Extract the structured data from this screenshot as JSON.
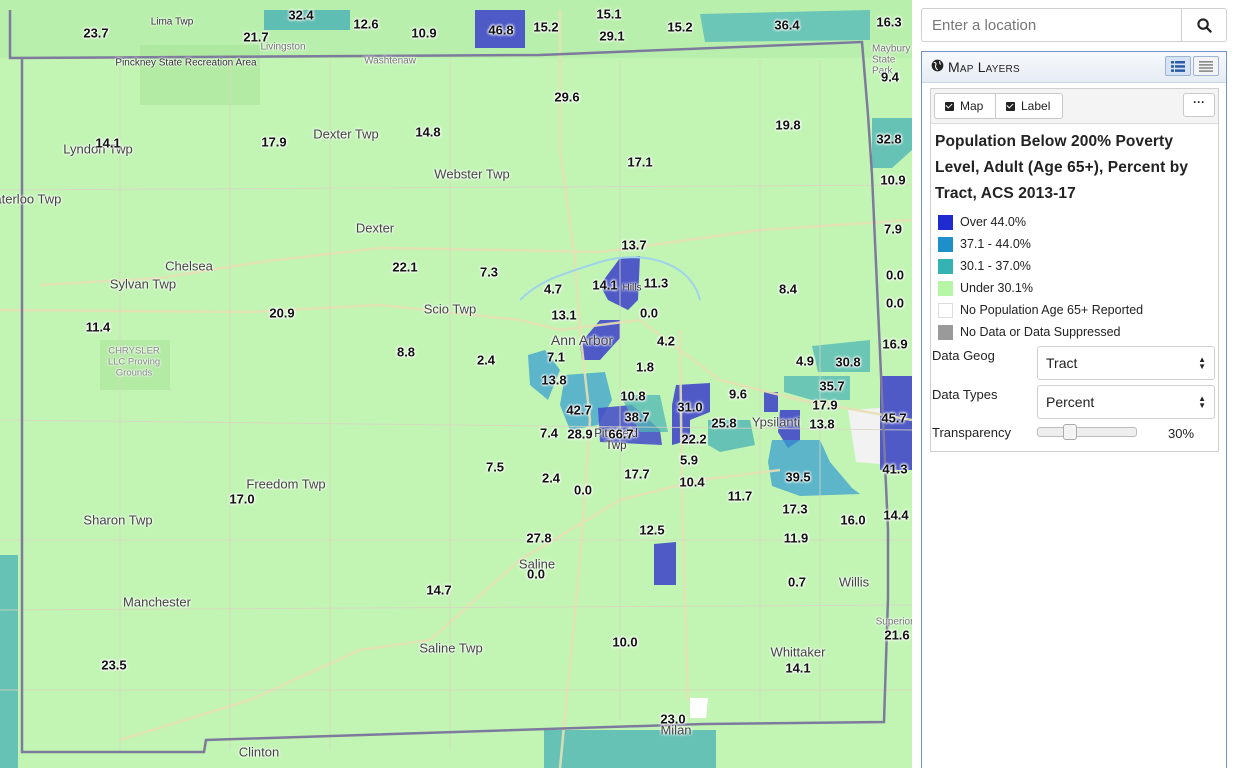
{
  "search": {
    "placeholder": "Enter a location"
  },
  "panel": {
    "title": "Map Layers",
    "toggles": {
      "map_label": "Map",
      "label_label": "Label"
    },
    "more_label": "···",
    "layer_title": "Population Below 200% Poverty Level, Adult (Age 65+), Percent by Tract, ACS 2013-17",
    "legend": [
      {
        "label": "Over 44.0%",
        "color": "#1f2bd0"
      },
      {
        "label": "37.1 - 44.0%",
        "color": "#1e8fc8"
      },
      {
        "label": "30.1 - 37.0%",
        "color": "#35b3b3"
      },
      {
        "label": "Under 30.1%",
        "color": "#b6f6a6"
      },
      {
        "label": "No Population Age 65+ Reported",
        "color": "#ffffff"
      },
      {
        "label": "No Data or Data Suppressed",
        "color": "#9a9a9a"
      }
    ],
    "data_geog": {
      "label": "Data Geog",
      "value": "Tract"
    },
    "data_types": {
      "label": "Data Types",
      "value": "Percent"
    },
    "transparency": {
      "label": "Transparency",
      "value": 0.3,
      "display": "30%"
    }
  },
  "map": {
    "values": [
      "32.4",
      "12.6",
      "10.9",
      "46.8",
      "15.2",
      "15.1",
      "29.1",
      "15.2",
      "36.4",
      "16.3",
      "23.7",
      "21.7",
      "9.4",
      "29.6",
      "14.1",
      "17.9",
      "14.8",
      "19.8",
      "32.8",
      "17.1",
      "10.9",
      "7.9",
      "13.7",
      "22.1",
      "7.3",
      "4.7",
      "14.1",
      "11.3",
      "8.4",
      "0.0",
      "0.0",
      "11.4",
      "20.9",
      "13.1",
      "0.0",
      "4.2",
      "16.9",
      "8.8",
      "2.4",
      "7.1",
      "1.8",
      "4.9",
      "30.8",
      "13.8",
      "35.7",
      "10.8",
      "9.6",
      "31.0",
      "17.9",
      "45.7",
      "42.7",
      "38.7",
      "25.8",
      "13.8",
      "7.4",
      "28.9",
      "66.7",
      "22.2",
      "41.3",
      "5.9",
      "7.5",
      "2.4",
      "17.7",
      "10.4",
      "39.5",
      "17.0",
      "0.0",
      "11.7",
      "17.3",
      "16.0",
      "14.4",
      "12.5",
      "27.8",
      "11.9",
      "0.0",
      "0.7",
      "14.7",
      "10.0",
      "21.6",
      "23.5",
      "14.1",
      "23.0"
    ],
    "places": [
      "Pinckney State Recreation Area",
      "Lyndon Twp",
      "Dexter Twp",
      "Webster Twp",
      "Waterloo Twp",
      "Dexter",
      "Chelsea",
      "Sylvan Twp",
      "Scio Twp",
      "Ann Arbor",
      "CHRYSLER LLC Proving Grounds",
      "Freedom Twp",
      "Sharon Twp",
      "Manchester",
      "Saline",
      "Saline Twp",
      "Ypsilanti",
      "Willis",
      "Whittaker",
      "Clinton",
      "Milan",
      "Pittsfield Twp",
      "Lima Twp",
      "Livingston",
      "Washtenaw",
      "Maybury State Park",
      "Superior Twp",
      "Hills"
    ]
  }
}
